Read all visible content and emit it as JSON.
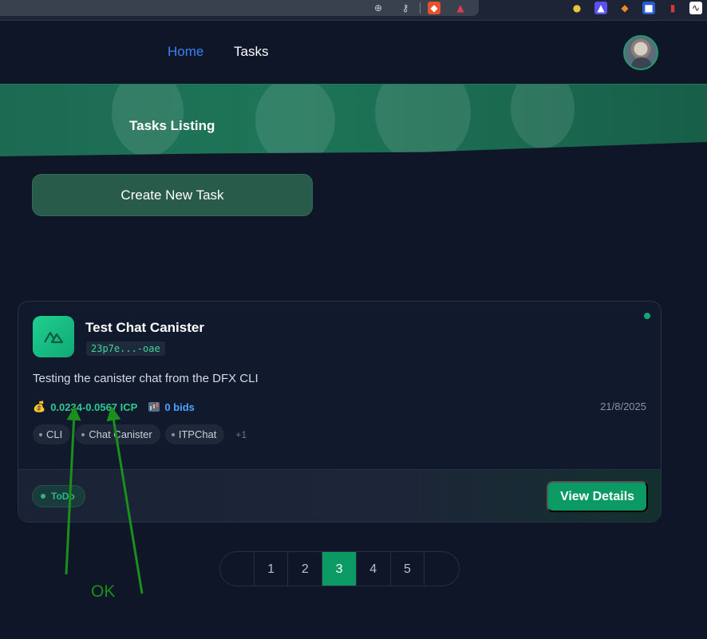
{
  "browser": {
    "icons": [
      "zoom-icon",
      "share-icon",
      "brave-shield-icon",
      "brave-rewards-icon",
      "extension-1-icon",
      "extension-2-icon",
      "metamask-icon",
      "extension-4-icon",
      "extension-5-icon",
      "extension-6-icon"
    ]
  },
  "nav": {
    "home": "Home",
    "tasks": "Tasks",
    "active_color": "#3b82f6"
  },
  "banner": {
    "title": "Tasks Listing"
  },
  "actions": {
    "create_label": "Create New Task"
  },
  "task": {
    "title": "Test Chat Canister",
    "id": "23p7e...-oae",
    "description": "Testing the canister chat from the DFX CLI",
    "price": "0.0234-0.0567 ICP",
    "bids": "0 bids",
    "date": "21/8/2025",
    "tags": [
      "CLI",
      "Chat Canister",
      "ITPChat"
    ],
    "more_tags": "+1",
    "status": "ToDo",
    "view_label": "View Details",
    "accent": "#0c9a64"
  },
  "pagination": {
    "pages": [
      "1",
      "2",
      "3",
      "4",
      "5"
    ],
    "current": "3"
  },
  "annotation": {
    "text": "OK",
    "color": "#1b8f1b"
  }
}
